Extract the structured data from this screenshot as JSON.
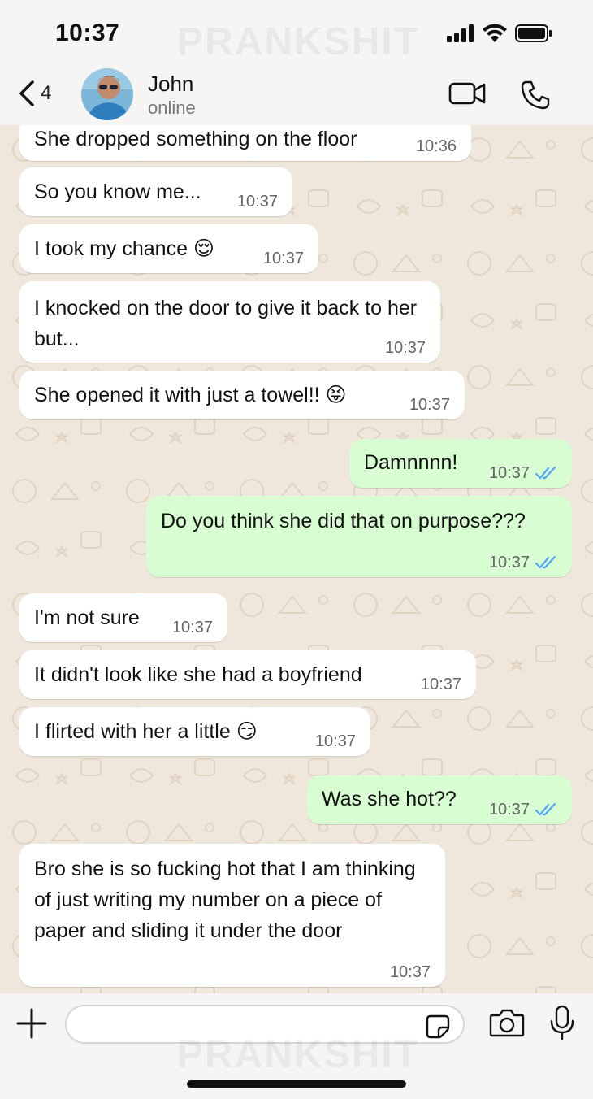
{
  "status_bar": {
    "time": "10:37"
  },
  "watermark": "PRANKSHIT",
  "header": {
    "back_count": "4",
    "contact_name": "John",
    "contact_status": "online"
  },
  "messages": [
    {
      "dir": "in",
      "text": "She dropped something on the floor",
      "time": "10:36"
    },
    {
      "dir": "in",
      "text": "So you know me...",
      "time": "10:37"
    },
    {
      "dir": "in",
      "text": "I took my chance 😌",
      "time": "10:37"
    },
    {
      "dir": "in",
      "text": "I knocked on the door to give it back to her but...",
      "time": "10:37"
    },
    {
      "dir": "in",
      "text": "She opened it with just a towel!! 😝",
      "time": "10:37"
    },
    {
      "dir": "out",
      "text": "Damnnnn!",
      "time": "10:37",
      "read": true
    },
    {
      "dir": "out",
      "text": "Do you think she did that on purpose???",
      "time": "10:37",
      "read": true
    },
    {
      "dir": "in",
      "text": "I'm not sure",
      "time": "10:37"
    },
    {
      "dir": "in",
      "text": "It didn't look like she had a boyfriend",
      "time": "10:37"
    },
    {
      "dir": "in",
      "text": "I flirted with her a little 😏",
      "time": "10:37"
    },
    {
      "dir": "out",
      "text": "Was she hot??",
      "time": "10:37",
      "read": true
    },
    {
      "dir": "in",
      "text": "Bro she is so fucking hot that I am thinking of just writing my number on a piece of paper and sliding it under the door",
      "time": "10:37"
    }
  ],
  "input": {
    "placeholder": ""
  },
  "colors": {
    "incoming": "#ffffff",
    "outgoing": "#d9fdd3",
    "read_tick": "#53a6f5",
    "wallpaper": "#efe7dc"
  }
}
